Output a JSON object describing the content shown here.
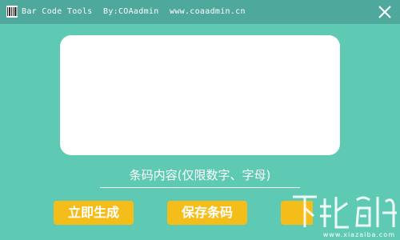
{
  "titlebar": {
    "app_name": "Bar Code Tools",
    "author": "By:COAadmin",
    "website": "www.coaadmin.cn"
  },
  "input": {
    "placeholder": "条码内容(仅限数字、字母)",
    "value": ""
  },
  "buttons": {
    "generate_label": "立即生成",
    "save_label": "保存条码",
    "third_label": ""
  },
  "watermark": {
    "text": "www.xiazaiba.com"
  },
  "colors": {
    "background": "#5ecab4",
    "titlebar": "#4fa89c",
    "button": "#f5bd1a",
    "preview": "#ffffff"
  },
  "icons": {
    "app": "barcode-icon",
    "close": "close-icon"
  }
}
